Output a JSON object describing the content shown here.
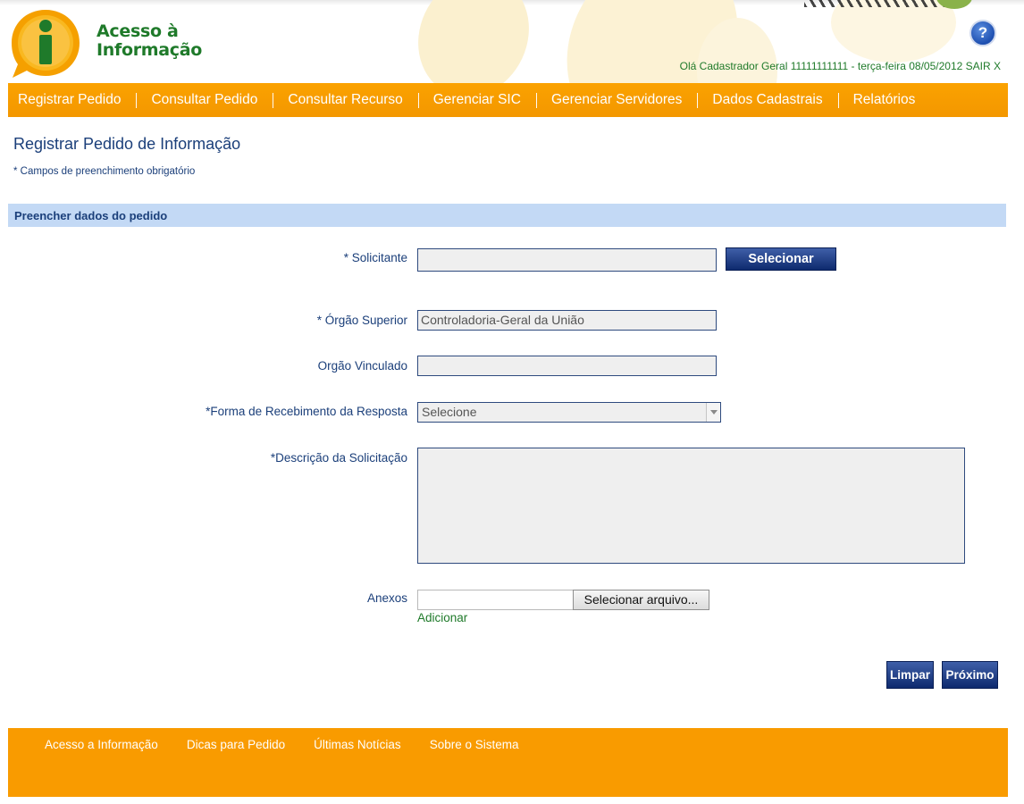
{
  "header": {
    "logo_line1": "Acesso à",
    "logo_line2": "Informação",
    "help_label": "?",
    "greeting": "Olá Cadastrador Geral 11111111111 - terça-feira 08/05/2012",
    "logout_label": "SAIR X"
  },
  "nav": {
    "items": [
      {
        "label": "Registrar Pedido"
      },
      {
        "label": "Consultar Pedido"
      },
      {
        "label": "Consultar Recurso"
      },
      {
        "label": "Gerenciar SIC"
      },
      {
        "label": "Gerenciar Servidores"
      },
      {
        "label": "Dados Cadastrais"
      },
      {
        "label": "Relatórios"
      }
    ]
  },
  "main": {
    "title": "Registrar Pedido de Informação",
    "required_note": "* Campos de preenchimento obrigatório",
    "section_title": "Preencher dados do pedido",
    "form": {
      "solicitante_label": "* Solicitante",
      "solicitante_value": "",
      "selecionar_label": "Selecionar",
      "orgao_superior_label": "* Órgão Superior",
      "orgao_superior_value": "Controladoria-Geral da União",
      "orgao_vinculado_label": "Orgão Vinculado",
      "orgao_vinculado_value": "",
      "forma_label": "*Forma de Recebimento da Resposta",
      "forma_value": "Selecione",
      "descricao_label": "*Descrição da Solicitação",
      "descricao_value": "",
      "anexos_label": "Anexos",
      "file_button_label": "Selecionar arquivo...",
      "adicionar_label": "Adicionar"
    },
    "actions": {
      "limpar_label": "Limpar",
      "proximo_label": "Próximo"
    }
  },
  "footer": {
    "links": [
      {
        "label": "Acesso a Informação"
      },
      {
        "label": "Dicas para Pedido"
      },
      {
        "label": "Últimas Notícias"
      },
      {
        "label": "Sobre o Sistema"
      }
    ]
  },
  "colors": {
    "accent_orange": "#f99b00",
    "brand_green": "#1f7a2a",
    "text_navy": "#1b3f7a",
    "section_blue": "#c3d9f5",
    "button_navy": "#0e2a6e"
  }
}
